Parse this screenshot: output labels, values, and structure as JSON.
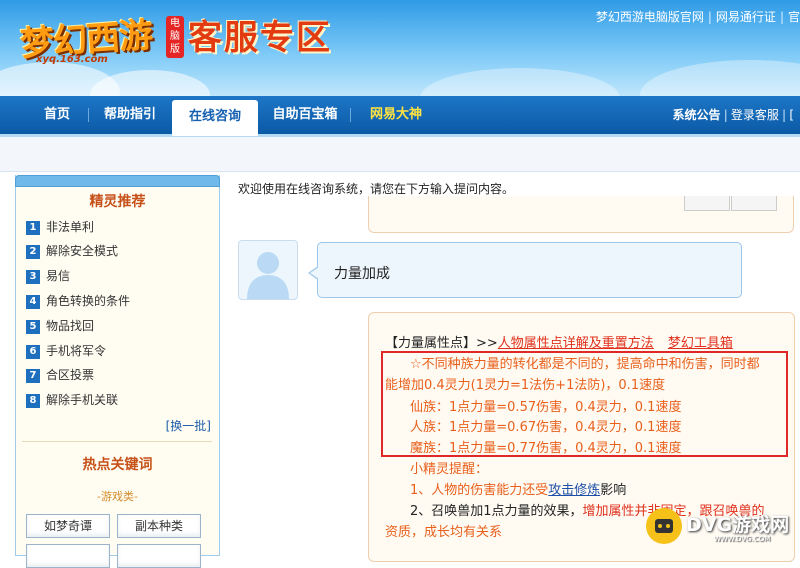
{
  "header": {
    "logo_text": "梦幻西游",
    "logo_badge": "电脑版",
    "logo_url": "xyq.163.com",
    "site_title": "客服专区",
    "top_links": [
      "梦幻西游电脑版官网",
      "网易通行证",
      "官"
    ]
  },
  "nav": {
    "items": [
      "首页",
      "帮助指引",
      "在线咨询",
      "自助百宝箱",
      "网易大神"
    ],
    "active": "在线咨询",
    "right_links": [
      "系统公告",
      "登录客服",
      "["
    ]
  },
  "sidebar": {
    "title": "精灵推荐",
    "items": [
      {
        "num": "1",
        "label": "非法单利"
      },
      {
        "num": "2",
        "label": "解除安全模式"
      },
      {
        "num": "3",
        "label": "易信"
      },
      {
        "num": "4",
        "label": "角色转换的条件"
      },
      {
        "num": "5",
        "label": "物品找回"
      },
      {
        "num": "6",
        "label": "手机将军令"
      },
      {
        "num": "7",
        "label": "合区投票"
      },
      {
        "num": "8",
        "label": "解除手机关联"
      }
    ],
    "refresh_label": "[换一批]",
    "hot_title": "热点关键词",
    "hot_category": "-游戏类-",
    "hot_keywords": [
      "如梦奇谭",
      "副本种类"
    ]
  },
  "chat": {
    "welcome": "欢迎使用在线咨询系统，请您在下方输入提问内容。",
    "user_question": "力量加成",
    "answer": {
      "heading": "【力量属性点】>>",
      "link1": "人物属性点详解及重置方法",
      "link2": "梦幻工具箱",
      "line1": "☆不同种族力量的转化都是不同的，提高命中和伤害，同时都",
      "line2": "能增加0.4灵力(1灵力=1法伤+1法防)，0.1速度",
      "line3": "仙族：1点力量=0.57伤害，0.4灵力，0.1速度",
      "line4": "人族：1点力量=0.67伤害，0.4灵力，0.1速度",
      "line5": "魔族：1点力量=0.77伤害，0.4灵力，0.1速度",
      "tip_title": "小精灵提醒：",
      "tip1_pre": "1、人物的伤害能力还受",
      "tip1_link": "攻击修炼",
      "tip1_post": "影响",
      "tip2_pre": "2、召唤兽加1点力量的效果，",
      "tip2_post": "增加属性并非固定，跟召唤兽的",
      "tip3": "资质，成长均有关系"
    }
  },
  "watermark": {
    "text": "DVG游戏网",
    "sub": "WWW.DVG.COM"
  },
  "colors": {
    "nav_blue": "#0b5aa6",
    "answer_orange": "#e8601c",
    "highlight_red": "#e12828"
  }
}
